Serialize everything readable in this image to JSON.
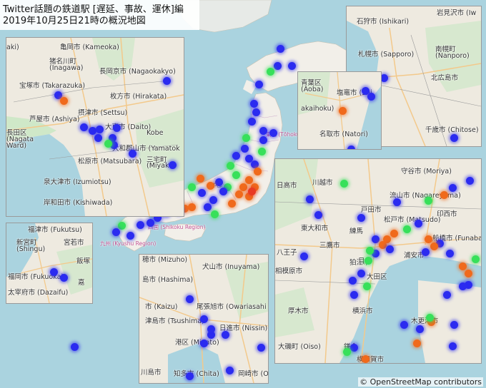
{
  "title": {
    "line1": "Twitter話題の鉄道駅 [遅延、事故、運休]編",
    "line2": "2019年10月25日21時の概況地図"
  },
  "credit": "© OpenStreetMap contributors",
  "colors": {
    "sea": "#aad3df",
    "land": "#f2efe9",
    "blue": "#2b2bf0",
    "green": "#37e05a",
    "orange": "#f06a1c"
  },
  "main_map_labels": {
    "chubu": "中部",
    "shikoku": "四国 (Shikoku Region)",
    "kyushu": "九州 (Kyushu Region)",
    "tohoku": "東北 (Tōhoku)",
    "chugoku": "中国"
  },
  "panels": {
    "kansai": {
      "labels": [
        "亀岡市 (Kameoka)",
        "猪名川町",
        "(Inagawa)",
        "長岡京市 (Nagaokakyo)",
        "宝塚市 (Takarazuka)",
        "枚方市 (Hirakata)",
        "摂津市 (Settsu)",
        "芦屋市 (Ashiya)",
        "大東市 (Daito)",
        "長田区",
        "(Nagata",
        "Ward)",
        "大和郡山市 (Yamatok",
        "松原市 (Matsubara)",
        "三宅町",
        "(Miyake",
        "泉大津市 (Izumiotsu)",
        "岸和田市 (Kishiwada)",
        "aki)",
        "Kobe"
      ]
    },
    "hokkaido": {
      "labels": [
        "石狩市 (Ishikari)",
        "岩見沢市 (Iw",
        "札幌市 (Sapporo)",
        "南幌町",
        "(Nanporo)",
        "北広島市",
        "千歳市 (Chitose)"
      ]
    },
    "sendai": {
      "labels": [
        "青葉区",
        "(Aoba)",
        "塩竈市 (Shi",
        "akaihoku)",
        "名取市 (Natori)"
      ]
    },
    "fukuoka": {
      "labels": [
        "福津市 (Fukutsu)",
        "宮若市",
        "新宮町",
        "(Shingu)",
        "飯塚",
        "福岡市 (Fukuoka)",
        "太宰府市 (Dazaifu)",
        "嘉"
      ]
    },
    "nagoya": {
      "labels": [
        "穂市 (Mizuho)",
        "犬山市 (Inuyama)",
        "島市 (Hashima)",
        "市 (Kaizu)",
        "尾張旭市 (Owariasahi",
        "津島市 (Tsushima)",
        "日進市 (Nissin)",
        "港区 (Minato)",
        "川島市",
        "知多市 (Chita)",
        "岡崎市 (O"
      ]
    },
    "kanto": {
      "labels": [
        "守谷市 (Moriya)",
        "川越市",
        "日高市",
        "流山市 (Nagareyama)",
        "戸田市",
        "印西市",
        "東大和市",
        "松戸市 (Matsudo)",
        "練馬",
        "船橋市 (Funabashi)",
        "狛江市",
        "三鷹市",
        "浦安市",
        "八王子",
        "相模原市",
        "目黒",
        "大田区",
        "厚木市",
        "横浜市",
        "木更津市",
        "鎌倉",
        "大磯町 (Oiso)",
        "横須賀市"
      ]
    }
  }
}
